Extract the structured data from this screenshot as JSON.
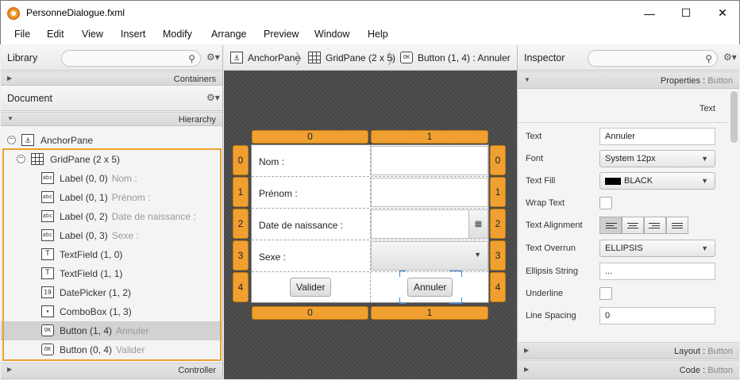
{
  "window": {
    "title": "PersonneDialogue.fxml",
    "min_glyph": "—",
    "max_glyph": "☐",
    "close_glyph": "✕"
  },
  "menu": [
    "File",
    "Edit",
    "View",
    "Insert",
    "Modify",
    "Arrange",
    "Preview",
    "Window",
    "Help"
  ],
  "library": {
    "title": "Library",
    "search_placeholder": "",
    "containers_label": "Containers"
  },
  "document": {
    "title": "Document",
    "hierarchy_label": "Hierarchy",
    "controller_label": "Controller",
    "tree": [
      {
        "icon": "anchor",
        "label": "AnchorPane",
        "sub": ""
      },
      {
        "icon": "grid",
        "label": "GridPane (2 x 5)",
        "sub": ""
      },
      {
        "icon": "abc",
        "label": "Label (0, 0)",
        "sub": "Nom :"
      },
      {
        "icon": "abc",
        "label": "Label (0, 1)",
        "sub": "Prénom :"
      },
      {
        "icon": "abc",
        "label": "Label (0, 2)",
        "sub": "Date de naissance :"
      },
      {
        "icon": "abc",
        "label": "Label (0, 3)",
        "sub": "Sexe :"
      },
      {
        "icon": "textfield",
        "label": "TextField (1, 0)",
        "sub": ""
      },
      {
        "icon": "textfield",
        "label": "TextField (1, 1)",
        "sub": ""
      },
      {
        "icon": "datepicker",
        "label": "DatePicker (1, 2)",
        "sub": ""
      },
      {
        "icon": "combobox",
        "label": "ComboBox (1, 3)",
        "sub": ""
      },
      {
        "icon": "ok",
        "label": "Button (1, 4)",
        "sub": "Annuler",
        "selected": true
      },
      {
        "icon": "ok",
        "label": "Button (0, 4)",
        "sub": "Valider"
      }
    ]
  },
  "breadcrumb": [
    {
      "icon": "anchor",
      "label": "AnchorPane"
    },
    {
      "icon": "grid",
      "label": "GridPane (2 x 5)"
    },
    {
      "icon": "ok",
      "label": "Button (1, 4) : Annuler"
    }
  ],
  "grid": {
    "col_headers": [
      "0",
      "1"
    ],
    "row_headers": [
      "0",
      "1",
      "2",
      "3",
      "4"
    ],
    "labels": [
      "Nom :",
      "Prénom :",
      "Date de naissance :",
      "Sexe :"
    ],
    "valider": "Valider",
    "annuler": "Annuler",
    "accent": "#f0a030"
  },
  "inspector": {
    "title": "Inspector",
    "properties_label": "Properties",
    "properties_target": "Button",
    "text_section": "Text",
    "props": {
      "text_label": "Text",
      "text_value": "Annuler",
      "font_label": "Font",
      "font_value": "System 12px",
      "fill_label": "Text Fill",
      "fill_value": "BLACK",
      "wrap_label": "Wrap Text",
      "align_label": "Text Alignment",
      "overrun_label": "Text Overrun",
      "overrun_value": "ELLIPSIS",
      "ellipsis_label": "Ellipsis String",
      "ellipsis_value": "...",
      "underline_label": "Underline",
      "spacing_label": "Line Spacing",
      "spacing_value": "0"
    },
    "layout_label": "Layout",
    "layout_target": "Button",
    "code_label": "Code",
    "code_target": "Button"
  }
}
